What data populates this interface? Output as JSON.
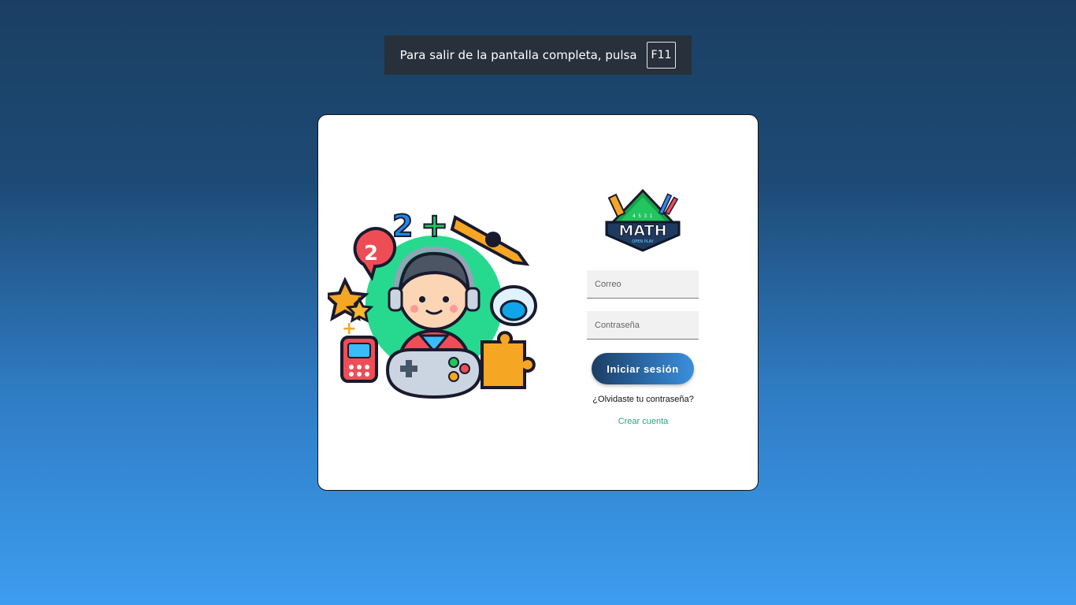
{
  "fullscreen_notice": {
    "text": "Para salir de la pantalla completa, pulsa",
    "key": "F11"
  },
  "illustration": {
    "icon": "child-gamer-math-illustration",
    "digit_badge": "2",
    "equation": "2",
    "symbol": "+"
  },
  "logo": {
    "title": "MATH",
    "subtitle": "OPEN PLAY",
    "numbers": "4 5 3 1"
  },
  "login_form": {
    "email_placeholder": "Correo",
    "password_placeholder": "Contraseña",
    "submit_label": "Iniciar sesión",
    "forgot_link": "¿Olvidaste tu contraseña?",
    "create_link": "Crear cuenta"
  },
  "colors": {
    "background_top": "#1b3f63",
    "background_bottom": "#3d9df0",
    "link_green": "#2aa67a",
    "button_dark": "#1c3d63",
    "button_light": "#3b8fdb"
  }
}
